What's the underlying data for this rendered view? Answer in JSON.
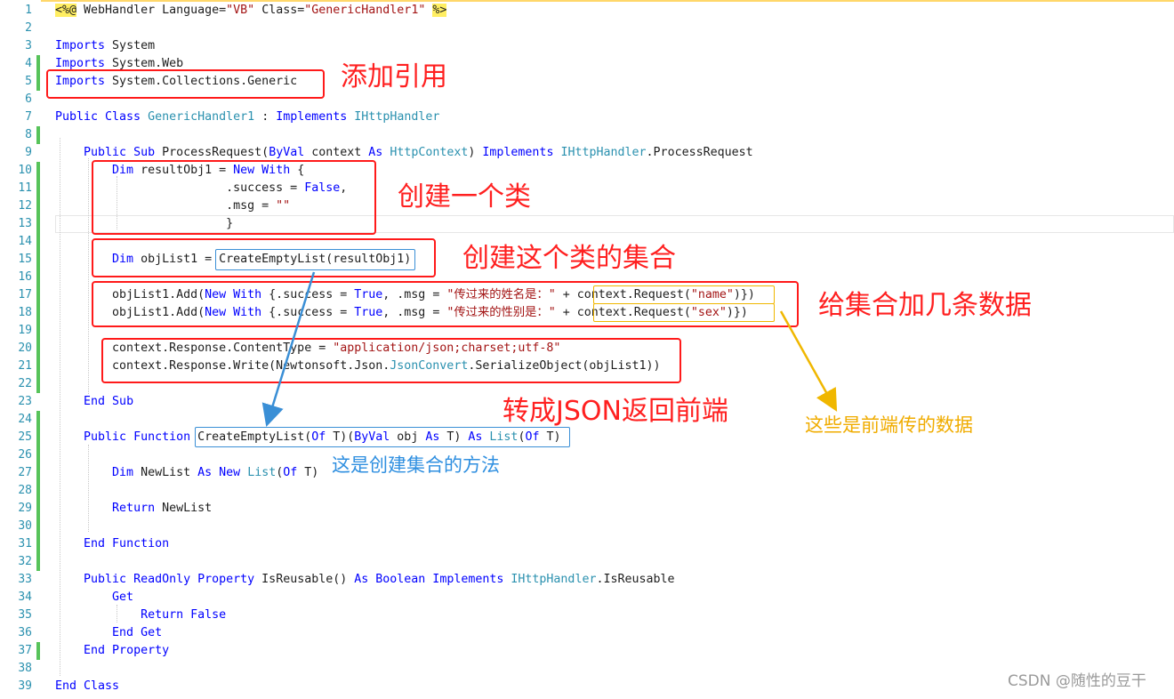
{
  "lines": [
    {
      "n": "1",
      "chg": false,
      "parts": [
        [
          "dir",
          "<%@"
        ],
        [
          "t",
          " WebHandler Language="
        ],
        [
          "st",
          "\"VB\""
        ],
        [
          "t",
          " Class="
        ],
        [
          "st",
          "\"GenericHandler1\""
        ],
        [
          "t",
          " "
        ],
        [
          "dir",
          "%>"
        ]
      ]
    },
    {
      "n": "2",
      "chg": false,
      "parts": []
    },
    {
      "n": "3",
      "chg": false,
      "parts": [
        [
          "kw",
          "Imports"
        ],
        [
          "t",
          " System"
        ]
      ]
    },
    {
      "n": "4",
      "chg": true,
      "parts": [
        [
          "kw",
          "Imports"
        ],
        [
          "t",
          " System.Web"
        ]
      ]
    },
    {
      "n": "5",
      "chg": true,
      "parts": [
        [
          "kw",
          "Imports"
        ],
        [
          "t",
          " System.Collections.Generic"
        ]
      ]
    },
    {
      "n": "6",
      "chg": false,
      "parts": []
    },
    {
      "n": "7",
      "chg": false,
      "parts": [
        [
          "kw",
          "Public Class"
        ],
        [
          "t",
          " "
        ],
        [
          "ty",
          "GenericHandler1"
        ],
        [
          "t",
          " : "
        ],
        [
          "kw",
          "Implements"
        ],
        [
          "t",
          " "
        ],
        [
          "ty",
          "IHttpHandler"
        ]
      ]
    },
    {
      "n": "8",
      "chg": true,
      "parts": []
    },
    {
      "n": "9",
      "chg": false,
      "parts": [
        [
          "t",
          "    "
        ],
        [
          "kw",
          "Public Sub"
        ],
        [
          "t",
          " ProcessRequest("
        ],
        [
          "kw",
          "ByVal"
        ],
        [
          "t",
          " context "
        ],
        [
          "kw",
          "As"
        ],
        [
          "t",
          " "
        ],
        [
          "ty",
          "HttpContext"
        ],
        [
          "t",
          ") "
        ],
        [
          "kw",
          "Implements"
        ],
        [
          "t",
          " "
        ],
        [
          "ty",
          "IHttpHandler"
        ],
        [
          "t",
          ".ProcessRequest"
        ]
      ]
    },
    {
      "n": "10",
      "chg": true,
      "parts": [
        [
          "t",
          "        "
        ],
        [
          "kw",
          "Dim"
        ],
        [
          "t",
          " resultObj1 = "
        ],
        [
          "kw",
          "New With"
        ],
        [
          "t",
          " {"
        ]
      ]
    },
    {
      "n": "11",
      "chg": true,
      "parts": [
        [
          "t",
          "                        .success = "
        ],
        [
          "kw",
          "False"
        ],
        [
          "t",
          ","
        ]
      ]
    },
    {
      "n": "12",
      "chg": true,
      "parts": [
        [
          "t",
          "                        .msg = "
        ],
        [
          "st",
          "\"\""
        ]
      ]
    },
    {
      "n": "13",
      "chg": true,
      "parts": [
        [
          "t",
          "                        }"
        ]
      ]
    },
    {
      "n": "14",
      "chg": true,
      "parts": []
    },
    {
      "n": "15",
      "chg": true,
      "parts": [
        [
          "t",
          "        "
        ],
        [
          "kw",
          "Dim"
        ],
        [
          "t",
          " objList1 = CreateEmptyList(resultObj1)"
        ]
      ]
    },
    {
      "n": "16",
      "chg": true,
      "parts": []
    },
    {
      "n": "17",
      "chg": true,
      "parts": [
        [
          "t",
          "        objList1.Add("
        ],
        [
          "kw",
          "New With"
        ],
        [
          "t",
          " {.success = "
        ],
        [
          "kw",
          "True"
        ],
        [
          "t",
          ", .msg = "
        ],
        [
          "st",
          "\"传过来的姓名是：\""
        ],
        [
          "t",
          " + context.Request("
        ],
        [
          "st",
          "\"name\""
        ],
        [
          "t",
          ")})"
        ]
      ]
    },
    {
      "n": "18",
      "chg": true,
      "parts": [
        [
          "t",
          "        objList1.Add("
        ],
        [
          "kw",
          "New With"
        ],
        [
          "t",
          " {.success = "
        ],
        [
          "kw",
          "True"
        ],
        [
          "t",
          ", .msg = "
        ],
        [
          "st",
          "\"传过来的性别是：\""
        ],
        [
          "t",
          " + context.Request("
        ],
        [
          "st",
          "\"sex\""
        ],
        [
          "t",
          ")})"
        ]
      ]
    },
    {
      "n": "19",
      "chg": true,
      "parts": []
    },
    {
      "n": "20",
      "chg": true,
      "parts": [
        [
          "t",
          "        context.Response.ContentType = "
        ],
        [
          "st",
          "\"application/json;charset;utf-8\""
        ]
      ]
    },
    {
      "n": "21",
      "chg": true,
      "parts": [
        [
          "t",
          "        context.Response.Write(Newtonsoft.Json."
        ],
        [
          "ty",
          "JsonConvert"
        ],
        [
          "t",
          ".SerializeObject(objList1))"
        ]
      ]
    },
    {
      "n": "22",
      "chg": true,
      "parts": []
    },
    {
      "n": "23",
      "chg": false,
      "parts": [
        [
          "t",
          "    "
        ],
        [
          "kw",
          "End Sub"
        ]
      ]
    },
    {
      "n": "24",
      "chg": true,
      "parts": []
    },
    {
      "n": "25",
      "chg": true,
      "parts": [
        [
          "t",
          "    "
        ],
        [
          "kw",
          "Public Function"
        ],
        [
          "t",
          " CreateEmptyList("
        ],
        [
          "kw",
          "Of"
        ],
        [
          "t",
          " T)("
        ],
        [
          "kw",
          "ByVal"
        ],
        [
          "t",
          " obj "
        ],
        [
          "kw",
          "As"
        ],
        [
          "t",
          " T) "
        ],
        [
          "kw",
          "As"
        ],
        [
          "t",
          " "
        ],
        [
          "ty",
          "List"
        ],
        [
          "t",
          "("
        ],
        [
          "kw",
          "Of"
        ],
        [
          "t",
          " T)"
        ]
      ]
    },
    {
      "n": "26",
      "chg": true,
      "parts": []
    },
    {
      "n": "27",
      "chg": true,
      "parts": [
        [
          "t",
          "        "
        ],
        [
          "kw",
          "Dim"
        ],
        [
          "t",
          " NewList "
        ],
        [
          "kw",
          "As New"
        ],
        [
          "t",
          " "
        ],
        [
          "ty",
          "List"
        ],
        [
          "t",
          "("
        ],
        [
          "kw",
          "Of"
        ],
        [
          "t",
          " T)"
        ]
      ]
    },
    {
      "n": "28",
      "chg": true,
      "parts": []
    },
    {
      "n": "29",
      "chg": true,
      "parts": [
        [
          "t",
          "        "
        ],
        [
          "kw",
          "Return"
        ],
        [
          "t",
          " NewList"
        ]
      ]
    },
    {
      "n": "30",
      "chg": true,
      "parts": []
    },
    {
      "n": "31",
      "chg": true,
      "parts": [
        [
          "t",
          "    "
        ],
        [
          "kw",
          "End Function"
        ]
      ]
    },
    {
      "n": "32",
      "chg": true,
      "parts": []
    },
    {
      "n": "33",
      "chg": false,
      "parts": [
        [
          "t",
          "    "
        ],
        [
          "kw",
          "Public ReadOnly Property"
        ],
        [
          "t",
          " IsReusable() "
        ],
        [
          "kw",
          "As Boolean Implements"
        ],
        [
          "t",
          " "
        ],
        [
          "ty",
          "IHttpHandler"
        ],
        [
          "t",
          ".IsReusable"
        ]
      ]
    },
    {
      "n": "34",
      "chg": false,
      "parts": [
        [
          "t",
          "        "
        ],
        [
          "kw",
          "Get"
        ]
      ]
    },
    {
      "n": "35",
      "chg": false,
      "parts": [
        [
          "t",
          "            "
        ],
        [
          "kw",
          "Return False"
        ]
      ]
    },
    {
      "n": "36",
      "chg": false,
      "parts": [
        [
          "t",
          "        "
        ],
        [
          "kw",
          "End Get"
        ]
      ]
    },
    {
      "n": "37",
      "chg": true,
      "parts": [
        [
          "t",
          "    "
        ],
        [
          "kw",
          "End Property"
        ]
      ]
    },
    {
      "n": "38",
      "chg": false,
      "parts": []
    },
    {
      "n": "39",
      "chg": false,
      "parts": [
        [
          "kw",
          "End Class"
        ]
      ]
    }
  ],
  "annotations": {
    "add_reference": "添加引用",
    "create_class": "创建一个类",
    "create_collection": "创建这个类的集合",
    "add_data": "给集合加几条数据",
    "to_json": "转成JSON返回前端",
    "method_note": "这是创建集合的方法",
    "frontend_note": "这些是前端传的数据"
  },
  "watermark": "CSDN @随性的豆干",
  "colors": {
    "keyword": "#0000ff",
    "type": "#2b91af",
    "string": "#a31515",
    "callout_red": "#ff1a1a",
    "callout_blue": "#3a8fd6",
    "callout_yellow": "#f0b700"
  }
}
